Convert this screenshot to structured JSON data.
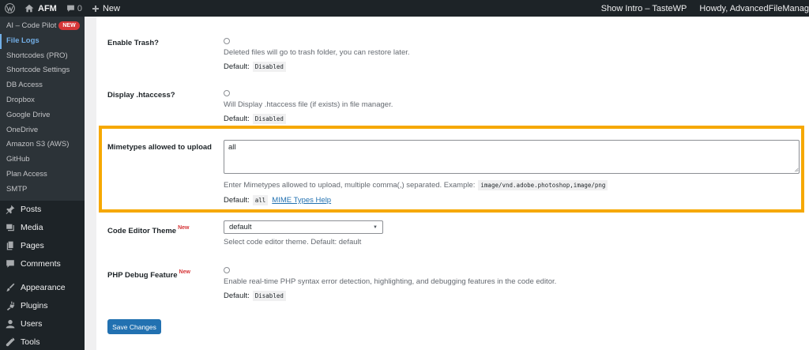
{
  "adminbar": {
    "site_name": "AFM",
    "comments_count": "0",
    "new_label": "New",
    "show_intro": "Show Intro – TasteWP",
    "howdy": "Howdy, AdvancedFileManag"
  },
  "sidebar": {
    "sub_items": [
      {
        "label": "AI – Code Pilot",
        "badge": "NEW"
      },
      {
        "label": "File Logs"
      },
      {
        "label": "Shortcodes (PRO)"
      },
      {
        "label": "Shortcode Settings"
      },
      {
        "label": "DB Access"
      },
      {
        "label": "Dropbox"
      },
      {
        "label": "Google Drive"
      },
      {
        "label": "OneDrive"
      },
      {
        "label": "Amazon S3 (AWS)"
      },
      {
        "label": "GitHub"
      },
      {
        "label": "Plan Access"
      },
      {
        "label": "SMTP"
      }
    ],
    "menu_items": [
      {
        "label": "Posts",
        "icon": "pin-icon"
      },
      {
        "label": "Media",
        "icon": "media-icon"
      },
      {
        "label": "Pages",
        "icon": "pages-icon"
      },
      {
        "label": "Comments",
        "icon": "comment-icon"
      },
      {
        "label": "Appearance",
        "icon": "brush-icon"
      },
      {
        "label": "Plugins",
        "icon": "plug-icon"
      },
      {
        "label": "Users",
        "icon": "user-icon"
      },
      {
        "label": "Tools",
        "icon": "wrench-icon"
      }
    ]
  },
  "settings": {
    "trash": {
      "label": "Enable Trash?",
      "desc": "Deleted files will go to trash folder, you can restore later.",
      "default_label": "Default:",
      "default_value": "Disabled"
    },
    "htaccess": {
      "label": "Display .htaccess?",
      "desc": "Will Display .htaccess file (if exists) in file manager.",
      "default_label": "Default:",
      "default_value": "Disabled"
    },
    "mimetypes": {
      "label": "Mimetypes allowed to upload",
      "value": "all",
      "desc": "Enter Mimetypes allowed to upload, multiple comma(,) separated. Example:",
      "example": "image/vnd.adobe.photoshop,image/png",
      "default_label": "Default:",
      "default_value": "all",
      "help_link": "MIME Types Help"
    },
    "editor_theme": {
      "label": "Code Editor Theme",
      "new_tag": "New",
      "selected": "default",
      "desc": "Select code editor theme. Default: default"
    },
    "php_debug": {
      "label": "PHP Debug Feature",
      "new_tag": "New",
      "desc": "Enable real-time PHP syntax error detection, highlighting, and debugging features in the code editor.",
      "default_label": "Default:",
      "default_value": "Disabled"
    }
  },
  "save_label": "Save Changes",
  "colors": {
    "highlight": "#f6a800",
    "primary": "#2271b1",
    "admin_dark": "#1d2327",
    "badge_red": "#d63638"
  }
}
